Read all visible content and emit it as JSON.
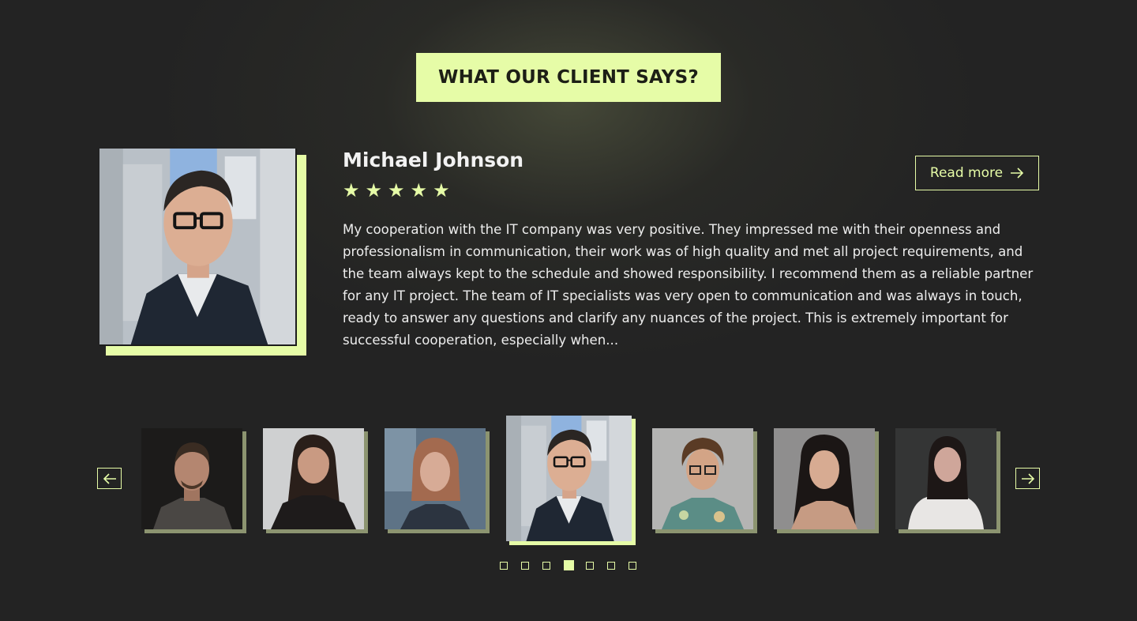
{
  "section": {
    "title": "WHAT OUR CLIENT SAYS?"
  },
  "testimonial": {
    "name": "Michael Johnson",
    "rating": 5,
    "stars": [
      "★",
      "★",
      "★",
      "★",
      "★"
    ],
    "read_more_label": "Read more",
    "text": "My cooperation with the IT company was very positive. They impressed me with their openness and professionalism in communication, their work was of high quality and met all project requirements, and the team always kept to the schedule and showed responsibility. I recommend them as a reliable partner for any IT project. The team of IT specialists was very open to communication and was always in touch, ready to answer any questions and clarify any nuances of the project. This is extremely important for successful cooperation, especially when..."
  },
  "carousel": {
    "prev_icon": "arrow-left-icon",
    "next_icon": "arrow-right-icon",
    "active_index": 3,
    "slide_count": 7
  },
  "colors": {
    "accent": "#e6fca7",
    "background": "#232323",
    "muted_accent": "#8c9470"
  }
}
